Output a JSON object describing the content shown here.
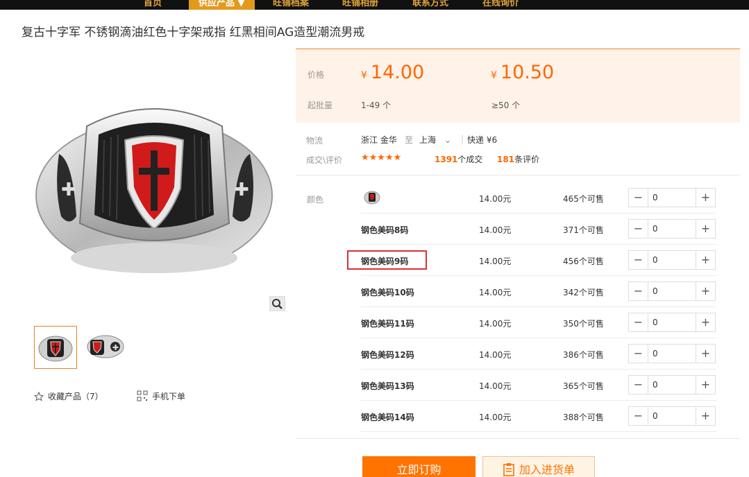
{
  "nav": {
    "items": [
      "首页",
      "供应产品",
      "旺铺档案",
      "旺铺相册",
      "联系方式",
      "在线询价"
    ],
    "active_index": 1
  },
  "product": {
    "title": "复古十字军 不锈钢滴油红色十字架戒指 红黑相间AG造型潮流男戒"
  },
  "gallery": {
    "favorite_label": "收藏产品（7）",
    "mobile_label": "手机下单"
  },
  "price": {
    "price_label": "价格",
    "currency": "¥",
    "tier1_price": "14.00",
    "tier2_price": "10.50",
    "moq_label": "起批量",
    "tier1_range": "1-49 个",
    "tier2_range": "≥50 个"
  },
  "logistics": {
    "label": "物流",
    "from": "浙江 金华",
    "to_word": "至",
    "to": "上海",
    "shipping": "快递 ¥6"
  },
  "reviews": {
    "label": "成交\\评价",
    "stars": "★★★★★",
    "deal_count": "1391",
    "deal_suffix": "个成交",
    "review_count": "181",
    "review_suffix": "条评价"
  },
  "sku": {
    "color_label": "颜色",
    "rows": [
      {
        "name": "",
        "price": "14.00元",
        "stock": "465个可售",
        "qty": "0"
      },
      {
        "name": "钢色美码8码",
        "price": "14.00元",
        "stock": "371个可售",
        "qty": "0"
      },
      {
        "name": "钢色美码9码",
        "price": "14.00元",
        "stock": "456个可售",
        "qty": "0"
      },
      {
        "name": "钢色美码10码",
        "price": "14.00元",
        "stock": "342个可售",
        "qty": "0"
      },
      {
        "name": "钢色美码11码",
        "price": "14.00元",
        "stock": "350个可售",
        "qty": "0"
      },
      {
        "name": "钢色美码12码",
        "price": "14.00元",
        "stock": "386个可售",
        "qty": "0"
      },
      {
        "name": "钢色美码13码",
        "price": "14.00元",
        "stock": "365个可售",
        "qty": "0"
      },
      {
        "name": "钢色美码14码",
        "price": "14.00元",
        "stock": "388个可售",
        "qty": "0"
      }
    ],
    "minus": "−",
    "plus": "+"
  },
  "actions": {
    "buy_label": "立即订购",
    "cart_label": "加入进货单"
  },
  "colors": {
    "accent": "#ff6600",
    "nav_bg": "#111111",
    "nav_active": "#e19a1d",
    "price_bg": "#fff2e8",
    "highlight": "#d93030"
  }
}
